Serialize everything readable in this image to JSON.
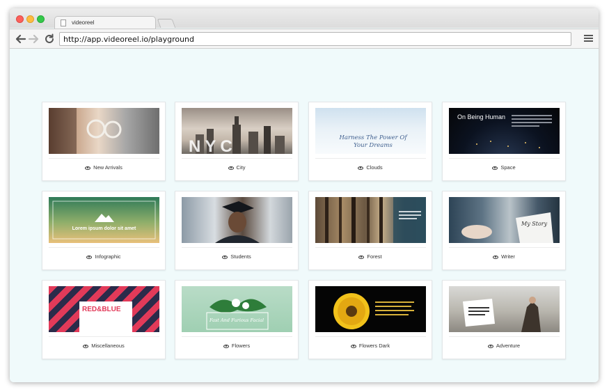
{
  "browser": {
    "tab_title": "videoreel",
    "url": "http://app.videoreel.io/playground"
  },
  "templates": [
    {
      "label": "New Arrivals"
    },
    {
      "label": "City",
      "overlay": "NYC"
    },
    {
      "label": "Clouds",
      "overlay": "Harness The Power Of Your Dreams"
    },
    {
      "label": "Space",
      "overlay": "On Being Human"
    },
    {
      "label": "Infographic",
      "overlay": "Lorem ipsum dolor sit amet"
    },
    {
      "label": "Students"
    },
    {
      "label": "Forest"
    },
    {
      "label": "Writer",
      "overlay": "My Story"
    },
    {
      "label": "Miscellaneous",
      "overlay": "RED&BLUE"
    },
    {
      "label": "Flowers",
      "overlay": "Fast And Furious Facial"
    },
    {
      "label": "Flowers Dark"
    },
    {
      "label": "Adventure"
    }
  ]
}
